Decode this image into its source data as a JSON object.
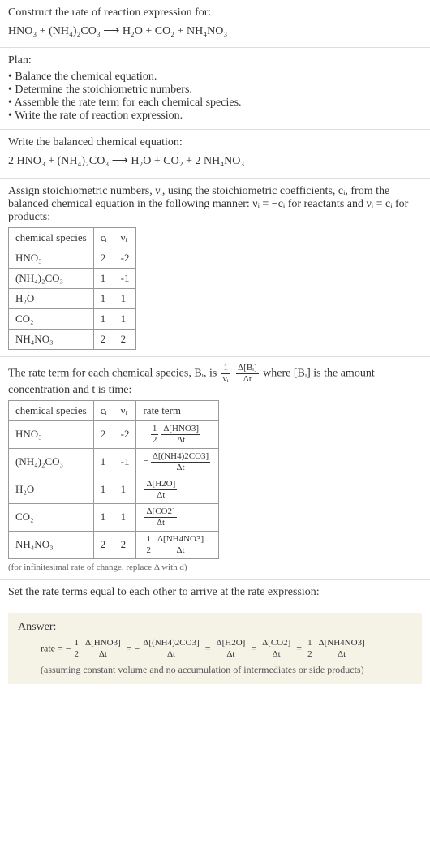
{
  "prompt": {
    "title": "Construct the rate of reaction expression for:",
    "equation": "HNO₃ + (NH₄)₂CO₃ ⟶ H₂O + CO₂ + NH₄NO₃"
  },
  "plan": {
    "title": "Plan:",
    "items": [
      "Balance the chemical equation.",
      "Determine the stoichiometric numbers.",
      "Assemble the rate term for each chemical species.",
      "Write the rate of reaction expression."
    ]
  },
  "balanced": {
    "title": "Write the balanced chemical equation:",
    "equation": "2 HNO₃ + (NH₄)₂CO₃ ⟶ H₂O + CO₂ + 2 NH₄NO₃"
  },
  "stoich": {
    "intro": "Assign stoichiometric numbers, νᵢ, using the stoichiometric coefficients, cᵢ, from the balanced chemical equation in the following manner: νᵢ = −cᵢ for reactants and νᵢ = cᵢ for products:",
    "headers": [
      "chemical species",
      "cᵢ",
      "νᵢ"
    ],
    "rows": [
      {
        "species": "HNO₃",
        "c": "2",
        "v": "-2"
      },
      {
        "species": "(NH₄)₂CO₃",
        "c": "1",
        "v": "-1"
      },
      {
        "species": "H₂O",
        "c": "1",
        "v": "1"
      },
      {
        "species": "CO₂",
        "c": "1",
        "v": "1"
      },
      {
        "species": "NH₄NO₃",
        "c": "2",
        "v": "2"
      }
    ]
  },
  "rate_terms": {
    "intro_a": "The rate term for each chemical species, Bᵢ, is ",
    "intro_b": " where [Bᵢ] is the amount concentration and t is time:",
    "headers": [
      "chemical species",
      "cᵢ",
      "νᵢ",
      "rate term"
    ],
    "rows": [
      {
        "species": "HNO₃",
        "c": "2",
        "v": "-2",
        "sign": "−",
        "coef_num": "1",
        "coef_den": "2",
        "delta": "Δ[HNO3]"
      },
      {
        "species": "(NH₄)₂CO₃",
        "c": "1",
        "v": "-1",
        "sign": "−",
        "coef_num": "",
        "coef_den": "",
        "delta": "Δ[(NH4)2CO3]"
      },
      {
        "species": "H₂O",
        "c": "1",
        "v": "1",
        "sign": "",
        "coef_num": "",
        "coef_den": "",
        "delta": "Δ[H2O]"
      },
      {
        "species": "CO₂",
        "c": "1",
        "v": "1",
        "sign": "",
        "coef_num": "",
        "coef_den": "",
        "delta": "Δ[CO2]"
      },
      {
        "species": "NH₄NO₃",
        "c": "2",
        "v": "2",
        "sign": "",
        "coef_num": "1",
        "coef_den": "2",
        "delta": "Δ[NH4NO3]"
      }
    ],
    "note": "(for infinitesimal rate of change, replace Δ with d)"
  },
  "final": {
    "title": "Set the rate terms equal to each other to arrive at the rate expression:",
    "answer_label": "Answer:",
    "rate_prefix": "rate = ",
    "terms": [
      {
        "sign": "−",
        "coef_num": "1",
        "coef_den": "2",
        "delta": "Δ[HNO3]"
      },
      {
        "sign": "−",
        "coef_num": "",
        "coef_den": "",
        "delta": "Δ[(NH4)2CO3]"
      },
      {
        "sign": "",
        "coef_num": "",
        "coef_den": "",
        "delta": "Δ[H2O]"
      },
      {
        "sign": "",
        "coef_num": "",
        "coef_den": "",
        "delta": "Δ[CO2]"
      },
      {
        "sign": "",
        "coef_num": "1",
        "coef_den": "2",
        "delta": "Δ[NH4NO3]"
      }
    ],
    "note": "(assuming constant volume and no accumulation of intermediates or side products)"
  },
  "chart_data": {
    "type": "table",
    "tables": [
      {
        "title": "Stoichiometric numbers",
        "columns": [
          "chemical species",
          "c_i",
          "ν_i"
        ],
        "rows": [
          [
            "HNO3",
            2,
            -2
          ],
          [
            "(NH4)2CO3",
            1,
            -1
          ],
          [
            "H2O",
            1,
            1
          ],
          [
            "CO2",
            1,
            1
          ],
          [
            "NH4NO3",
            2,
            2
          ]
        ]
      },
      {
        "title": "Rate terms",
        "columns": [
          "chemical species",
          "c_i",
          "ν_i",
          "rate term"
        ],
        "rows": [
          [
            "HNO3",
            2,
            -2,
            "-(1/2) Δ[HNO3]/Δt"
          ],
          [
            "(NH4)2CO3",
            1,
            -1,
            "-Δ[(NH4)2CO3]/Δt"
          ],
          [
            "H2O",
            1,
            1,
            "Δ[H2O]/Δt"
          ],
          [
            "CO2",
            1,
            1,
            "Δ[CO2]/Δt"
          ],
          [
            "NH4NO3",
            2,
            2,
            "(1/2) Δ[NH4NO3]/Δt"
          ]
        ]
      }
    ],
    "rate_expression": "rate = -(1/2) Δ[HNO3]/Δt = -Δ[(NH4)2CO3]/Δt = Δ[H2O]/Δt = Δ[CO2]/Δt = (1/2) Δ[NH4NO3]/Δt"
  }
}
